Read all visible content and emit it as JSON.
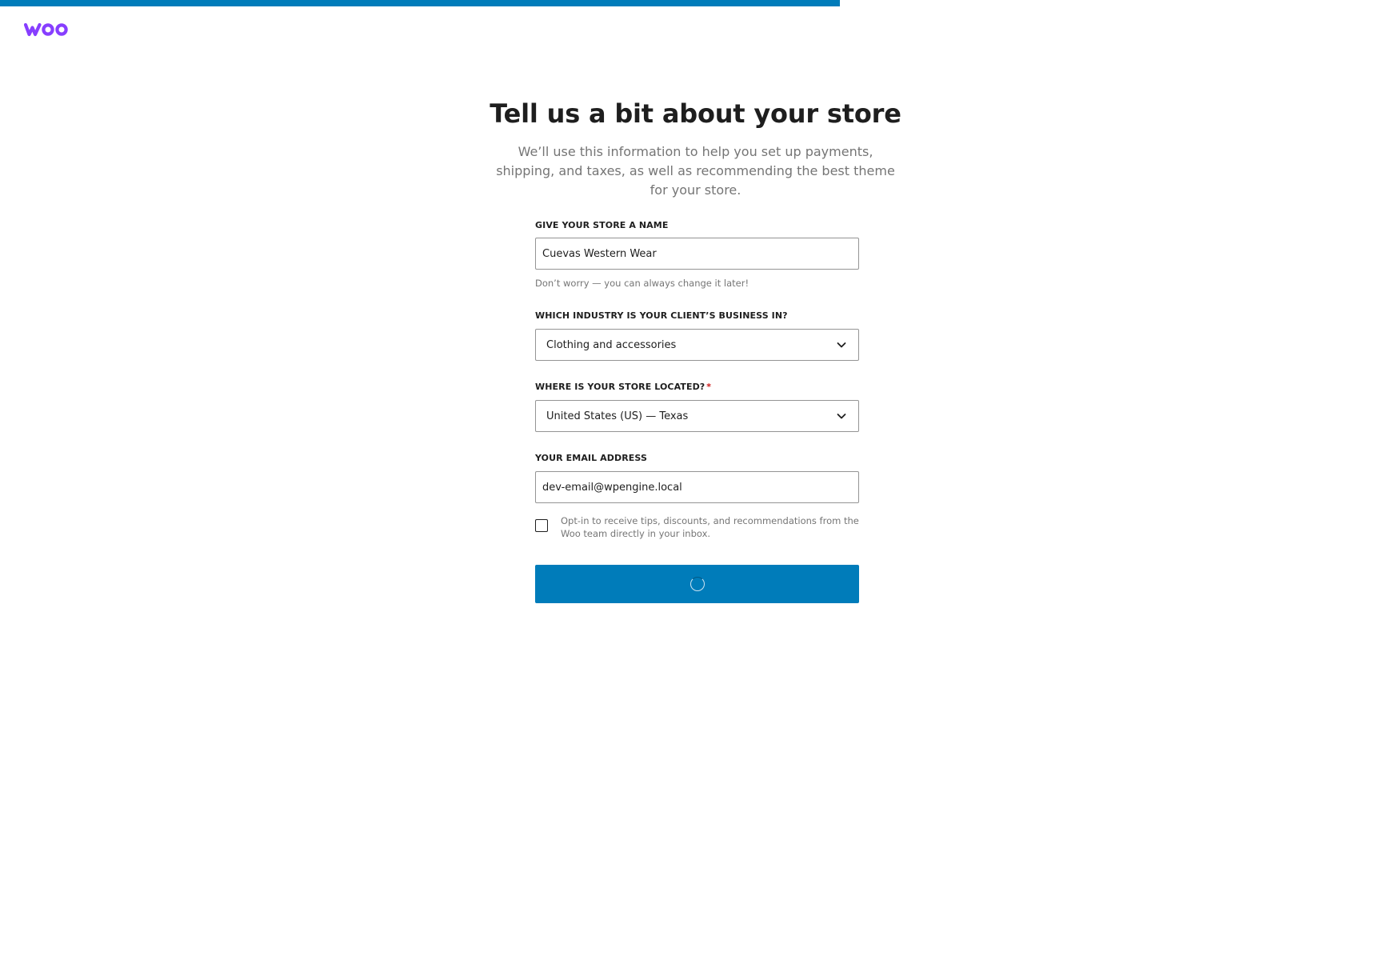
{
  "progress": {
    "value_percent": 60.4,
    "color": "#007cba"
  },
  "logo": {
    "text": "woo",
    "color": "#873eff"
  },
  "header": {
    "title": "Tell us a bit about your store",
    "subtitle": "We’ll use this information to help you set up payments, shipping, and taxes, as well as recommending the best theme for your store."
  },
  "form": {
    "store_name": {
      "label": "GIVE YOUR STORE A NAME",
      "value": "Cuevas Western Wear",
      "help": "Don’t worry — you can always change it later!"
    },
    "industry": {
      "label": "WHICH INDUSTRY IS YOUR CLIENT’S BUSINESS IN?",
      "selected": "Clothing and accessories",
      "icon": "chevron-down-icon"
    },
    "location": {
      "label": "WHERE IS YOUR STORE LOCATED?",
      "required_mark": "*",
      "selected": "United States (US) — Texas",
      "icon": "chevron-down-icon"
    },
    "email": {
      "label": "YOUR EMAIL ADDRESS",
      "value": "dev-email@wpengine.local"
    },
    "opt_in": {
      "checked": false,
      "label": "Opt-in to receive tips, discounts, and recommendations from the Woo team directly in your inbox."
    },
    "submit": {
      "state": "loading",
      "icon": "spinner-icon",
      "color": "#007cba"
    }
  }
}
